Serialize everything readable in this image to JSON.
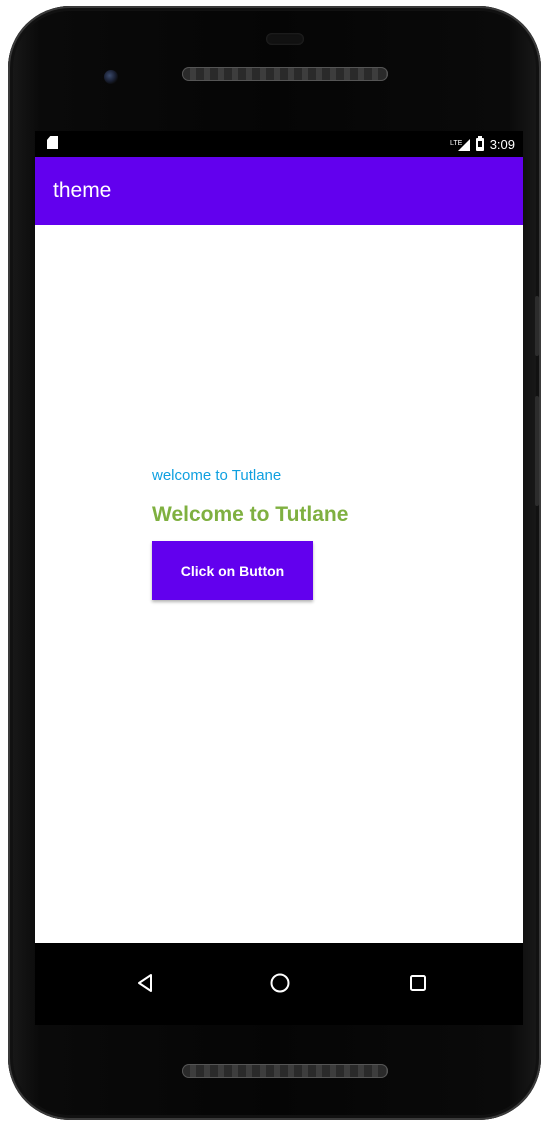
{
  "status_bar": {
    "time": "3:09",
    "left_icon": "sd-card-icon",
    "signal_icon": "signal-icon",
    "battery_icon": "battery-icon"
  },
  "app_bar": {
    "title": "theme",
    "color": "#6200EE"
  },
  "content": {
    "small_text": "welcome to Tutlane",
    "small_text_color": "#0FA0E0",
    "big_text": "Welcome to Tutlane",
    "big_text_color": "#7FB040",
    "button_label": "Click on Button",
    "button_color": "#6200EE"
  },
  "nav_bar": {
    "back_icon": "back-triangle-icon",
    "home_icon": "home-circle-icon",
    "recents_icon": "recents-square-icon"
  }
}
